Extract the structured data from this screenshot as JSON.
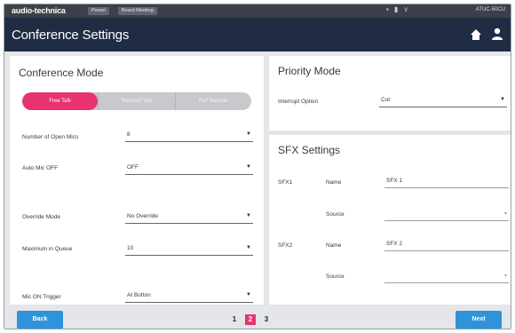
{
  "statusbar": {
    "brand": "audio-technica",
    "chip_preset": "Preset",
    "chip_meeting": "Board Meeting",
    "model": "ATUC-50CU"
  },
  "header": {
    "title": "Conference Settings"
  },
  "conference": {
    "title": "Conference Mode",
    "modes": [
      "Free Talk",
      "Request Talk",
      "Full Remote"
    ],
    "active_mode": 0,
    "rows": [
      {
        "label": "Number of Open Mics",
        "value": "8"
      },
      {
        "label": "Auto Mic OFF",
        "value": "OFF"
      },
      {
        "label": "Override Mode",
        "value": "No Override"
      },
      {
        "label": "Maximum in Queue",
        "value": "10"
      },
      {
        "label": "Mic ON Trigger",
        "value": "At Button"
      }
    ]
  },
  "priority": {
    "title": "Priority Mode",
    "label": "Interrupt Option",
    "value": "Cut"
  },
  "sfx": {
    "title": "SFX Settings",
    "items": [
      {
        "id": "SFX1",
        "name_label": "Name",
        "name": "SFX 1",
        "source_label": "Source",
        "source": ""
      },
      {
        "id": "SFX2",
        "name_label": "Name",
        "name": "SFX 2",
        "source_label": "Source",
        "source": ""
      }
    ]
  },
  "footer": {
    "back": "Back",
    "next": "Next",
    "pages": [
      "1",
      "2",
      "3"
    ],
    "current_page": 2
  },
  "colors": {
    "accent": "#e8336f",
    "button": "#2f93db",
    "titlebar": "#1f2c44"
  }
}
